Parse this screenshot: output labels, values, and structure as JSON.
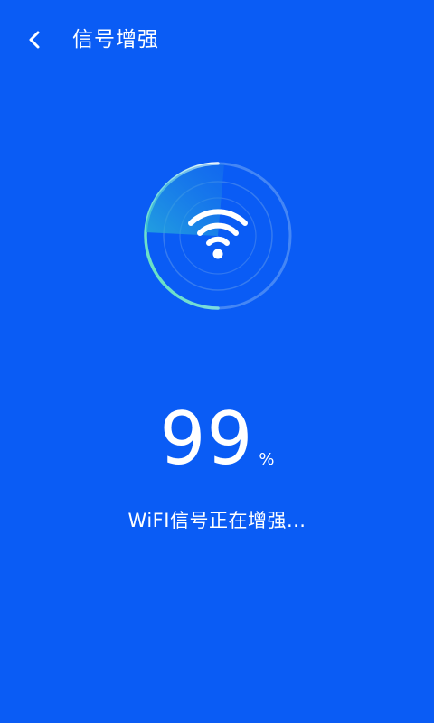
{
  "header": {
    "back_icon": "chevron-left-icon",
    "title": "信号增强"
  },
  "scanner": {
    "icon": "wifi-icon",
    "progress_fraction": 0.99
  },
  "progress": {
    "value": "99",
    "unit": "%"
  },
  "status": {
    "text": "WiFI信号正在增强..."
  },
  "colors": {
    "background": "#0a5cf5",
    "ring_gradient_start": "#5fe6b4",
    "ring_track": "#4f8df5",
    "sweep": "#2ab7d8",
    "text": "#ffffff"
  }
}
